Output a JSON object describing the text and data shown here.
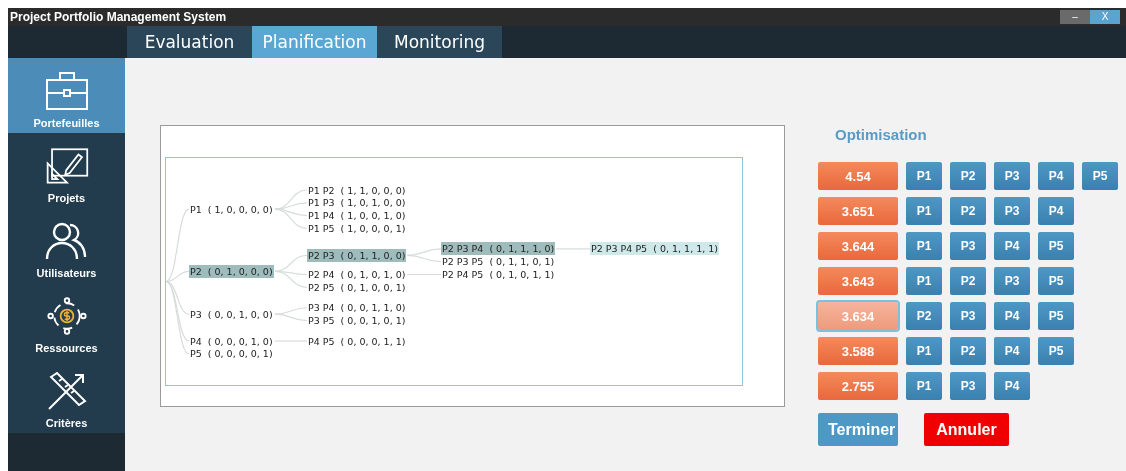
{
  "window": {
    "title": "Project Portfolio Management System",
    "controls": [
      {
        "kind": "minimize",
        "label": "–"
      },
      {
        "kind": "close",
        "label": "X"
      }
    ]
  },
  "tabs": [
    {
      "label": "Evaluation",
      "selected": false
    },
    {
      "label": "Planification",
      "selected": true
    },
    {
      "label": "Monitoring",
      "selected": false
    }
  ],
  "sidebar": {
    "items": [
      {
        "label": "Portefeuilles",
        "selected": true
      },
      {
        "label": "Projets",
        "selected": false
      },
      {
        "label": "Utilisateurs",
        "selected": false
      },
      {
        "label": "Ressources",
        "selected": false
      },
      {
        "label": "Critères",
        "selected": false
      }
    ]
  },
  "tree": {
    "nodes": [
      {
        "label": "P1  ( 1, 0, 0, 0, 0)",
        "selected": false,
        "current": false,
        "children": [
          {
            "label": "P1 P2  ( 1, 1, 0, 0, 0)",
            "selected": false,
            "current": false
          },
          {
            "label": "P1 P3  ( 1, 0, 1, 0, 0)",
            "selected": false,
            "current": false
          },
          {
            "label": "P1 P4  ( 1, 0, 0, 1, 0)",
            "selected": false,
            "current": false
          },
          {
            "label": "P1 P5  ( 1, 0, 0, 0, 1)",
            "selected": false,
            "current": false
          }
        ]
      },
      {
        "label": "P2  ( 0, 1, 0, 0, 0)",
        "selected": true,
        "current": false,
        "children": [
          {
            "label": "P2 P3  ( 0, 1, 1, 0, 0)",
            "selected": true,
            "current": false,
            "children": [
              {
                "label": "P2 P3 P4  ( 0, 1, 1, 1, 0)",
                "selected": true,
                "current": false,
                "children": [
                  {
                    "label": "P2 P3 P4 P5  ( 0, 1, 1, 1, 1)",
                    "selected": false,
                    "current": true
                  }
                ]
              },
              {
                "label": "P2 P3 P5  ( 0, 1, 1, 0, 1)",
                "selected": false,
                "current": false
              }
            ]
          },
          {
            "label": "P2 P4  ( 0, 1, 0, 1, 0)",
            "selected": false,
            "current": false,
            "children": [
              {
                "label": "P2 P4 P5  ( 0, 1, 0, 1, 1)",
                "selected": false,
                "current": false
              }
            ]
          },
          {
            "label": "P2 P5  ( 0, 1, 0, 0, 1)",
            "selected": false,
            "current": false
          }
        ]
      },
      {
        "label": "P3  ( 0, 0, 1, 0, 0)",
        "selected": false,
        "current": false,
        "children": [
          {
            "label": "P3 P4  ( 0, 0, 1, 1, 0)",
            "selected": false,
            "current": false
          },
          {
            "label": "P3 P5  ( 0, 0, 1, 0, 1)",
            "selected": false,
            "current": false
          }
        ]
      },
      {
        "label": "P4  ( 0, 0, 0, 1, 0)",
        "selected": false,
        "current": false,
        "children": [
          {
            "label": "P4 P5  ( 0, 0, 0, 1, 1)",
            "selected": false,
            "current": false
          }
        ]
      },
      {
        "label": "P5  ( 0, 0, 0, 0, 1)",
        "selected": false,
        "current": false
      }
    ]
  },
  "optimisation": {
    "title": "Optimisation",
    "solutions": [
      {
        "score": "4.54",
        "selected": false,
        "projects": [
          "P1",
          "P2",
          "P3",
          "P4",
          "P5"
        ]
      },
      {
        "score": "3.651",
        "selected": false,
        "projects": [
          "P1",
          "P2",
          "P3",
          "P4"
        ]
      },
      {
        "score": "3.644",
        "selected": false,
        "projects": [
          "P1",
          "P3",
          "P4",
          "P5"
        ]
      },
      {
        "score": "3.643",
        "selected": false,
        "projects": [
          "P1",
          "P2",
          "P3",
          "P5"
        ]
      },
      {
        "score": "3.634",
        "selected": true,
        "projects": [
          "P2",
          "P3",
          "P4",
          "P5"
        ]
      },
      {
        "score": "3.588",
        "selected": false,
        "projects": [
          "P1",
          "P2",
          "P4",
          "P5"
        ]
      },
      {
        "score": "2.755",
        "selected": false,
        "projects": [
          "P1",
          "P3",
          "P4"
        ]
      }
    ]
  },
  "buttons": [
    {
      "kind": "primary",
      "label": "Terminer"
    },
    {
      "kind": "danger",
      "label": "Annuler"
    }
  ]
}
